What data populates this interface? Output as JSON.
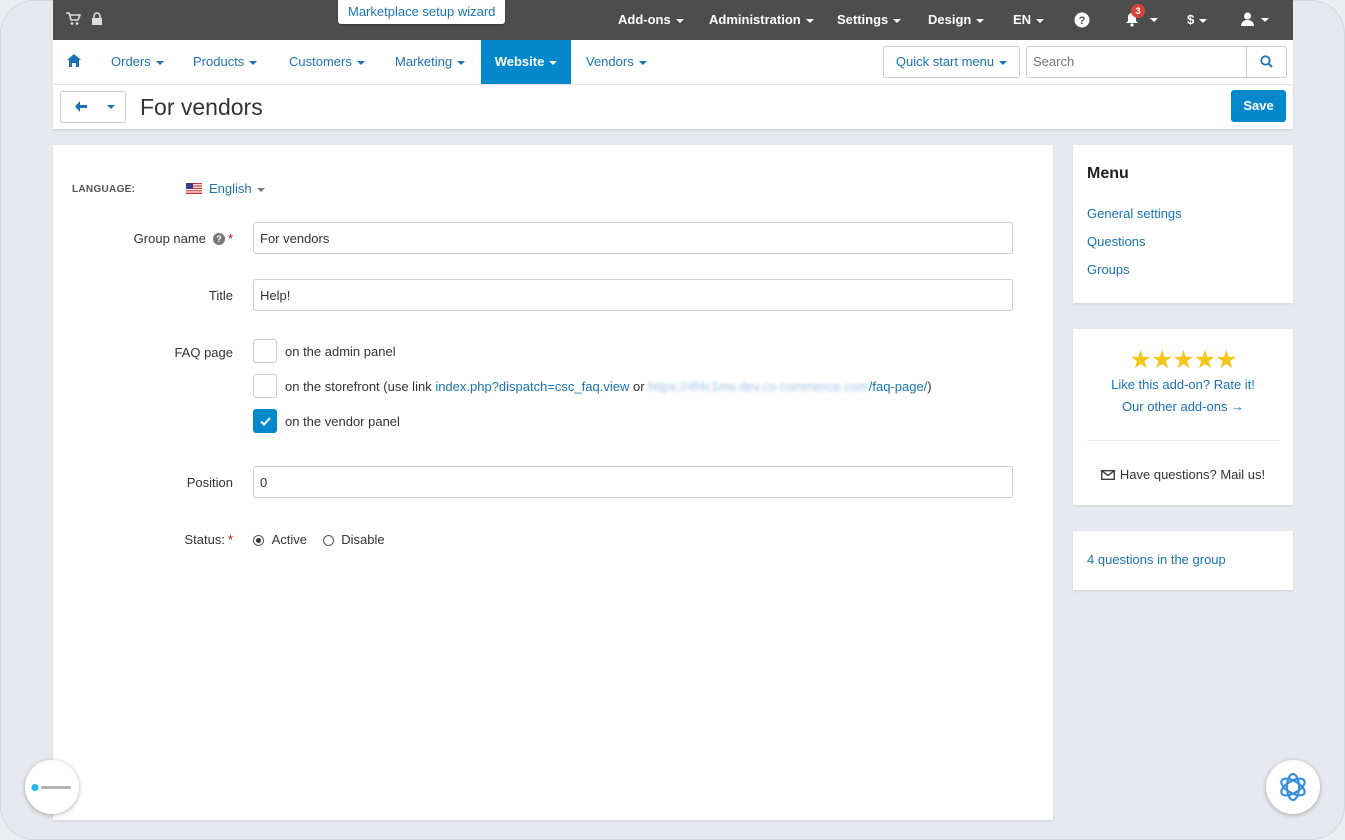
{
  "topbar": {
    "wizard_label": "Marketplace setup wizard",
    "menus": [
      "Add-ons",
      "Administration",
      "Settings",
      "Design",
      "EN"
    ],
    "notifications_count": "3",
    "currency_symbol": "$"
  },
  "nav": {
    "items": [
      "Orders",
      "Products",
      "Customers",
      "Marketing",
      "Website",
      "Vendors"
    ],
    "active": "Website",
    "quick_start": "Quick start menu",
    "search_placeholder": "Search"
  },
  "page": {
    "title": "For vendors",
    "save_label": "Save"
  },
  "form": {
    "language_label": "LANGUAGE:",
    "language_value": "English",
    "group_name_label": "Group name",
    "group_name_value": "For vendors",
    "title_label": "Title",
    "title_value": "Help!",
    "faq_label": "FAQ page",
    "faq_admin": "on the admin panel",
    "faq_store_prefix": "on the storefront (use link ",
    "faq_store_link": "index.php?dispatch=csc_faq.view",
    "faq_store_or": " or ",
    "faq_store_url_blurred": "https://4f4c1mv.dev.cs-commerce.com",
    "faq_store_url_suffix": "/faq-page/",
    "faq_store_close": ")",
    "faq_vendor": "on the vendor panel",
    "faq_checked": {
      "admin": false,
      "storefront": false,
      "vendor": true
    },
    "position_label": "Position",
    "position_value": "0",
    "status_label": "Status:",
    "status_options": [
      "Active",
      "Disable"
    ],
    "status_selected": "Active"
  },
  "sidebar": {
    "menu_title": "Menu",
    "menu_links": [
      "General settings",
      "Questions",
      "Groups"
    ],
    "rating_stars": 5,
    "rate_text": "Like this add-on? Rate it!",
    "other_addons": "Our other add-ons →",
    "mail_text": "Have questions? Mail us!",
    "questions_count_text": "4 questions in the group"
  },
  "colors": {
    "topbar_bg": "#4d4d4d",
    "accent": "#0388cc",
    "link": "#1a73b5",
    "star": "#f5c518"
  }
}
